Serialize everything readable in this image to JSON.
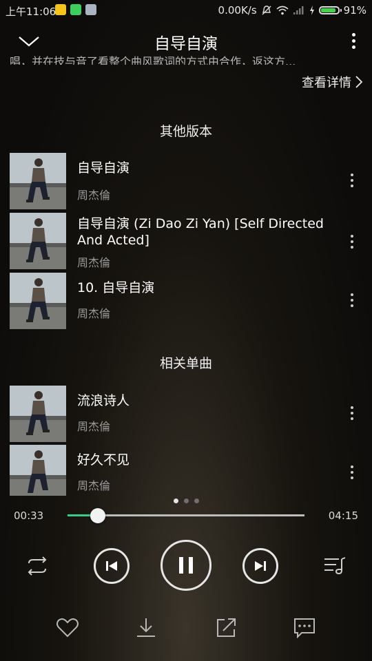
{
  "status_bar": {
    "time": "上午11:06",
    "net_speed": "0.00K/s",
    "battery": "91%",
    "battery_level": 0.91,
    "app_icons": [
      {
        "name": "qq-icon",
        "color": "#f5c518"
      },
      {
        "name": "android-icon",
        "color": "#3ccf5b"
      },
      {
        "name": "notes-icon",
        "color": "#aab4c0"
      }
    ]
  },
  "header": {
    "title": "自导自演"
  },
  "description": {
    "fade_text": "唱，并在技与音了看整个曲风歌词的方式由合作，返这方...",
    "detail_link": "查看详情"
  },
  "other_versions": {
    "title": "其他版本",
    "items": [
      {
        "name": "自导自演",
        "artist": "周杰倫"
      },
      {
        "name": "自导自演 (Zi Dao Zi Yan) [Self Directed And Acted]",
        "artist": "周杰倫"
      },
      {
        "name": "10. 自导自演",
        "artist": "周杰倫"
      }
    ]
  },
  "related_songs": {
    "title": "相关单曲",
    "items": [
      {
        "name": "流浪诗人",
        "artist": "周杰倫"
      },
      {
        "name": "好久不见",
        "artist": "周杰倫"
      }
    ]
  },
  "player": {
    "current_time": "00:33",
    "total_time": "04:15",
    "progress": 0.129,
    "accent_color": "#2fd288",
    "pager_active_index": 0,
    "pager_count": 3
  },
  "controls": [
    "repeat-icon",
    "previous-icon",
    "pause-icon",
    "next-icon",
    "playlist-icon"
  ],
  "actions": [
    "heart-icon",
    "download-icon",
    "share-icon",
    "comment-icon"
  ]
}
